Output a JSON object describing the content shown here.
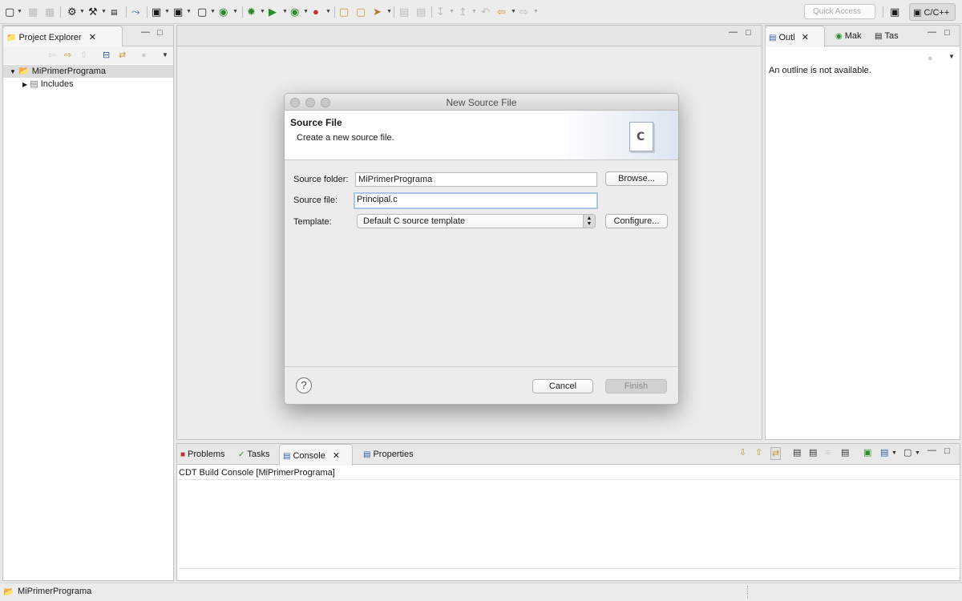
{
  "toolbar": {
    "quick_access_placeholder": "Quick Access",
    "perspective_label": "C/C++",
    "icons": [
      "new-icon",
      "save-icon",
      "save-all-icon",
      "build-config-icon",
      "build-icon",
      "binary-icon",
      "skip-breakpoints-icon",
      "new-c-project-icon",
      "new-folder-icon",
      "new-source-file-icon",
      "new-class-icon",
      "debug-icon",
      "run-icon",
      "run-coverage-icon",
      "external-tools-icon",
      "open-type-icon",
      "open-element-icon",
      "search-icon",
      "prev-annotation-icon",
      "next-annotation-icon",
      "back-icon",
      "forward-icon"
    ]
  },
  "explorer": {
    "tab_label": "Project Explorer",
    "tree": [
      {
        "label": "MiPrimerPrograma",
        "expanded": true
      },
      {
        "label": "Includes",
        "expanded": false
      }
    ]
  },
  "outline": {
    "tabs": [
      {
        "label": "Outl"
      },
      {
        "label": "Mak"
      },
      {
        "label": "Tas"
      }
    ],
    "message": "An outline is not available."
  },
  "console": {
    "tabs": [
      {
        "label": "Problems"
      },
      {
        "label": "Tasks"
      },
      {
        "label": "Console"
      },
      {
        "label": "Properties"
      }
    ],
    "header": "CDT Build Console [MiPrimerPrograma]"
  },
  "statusbar": {
    "text": "MiPrimerPrograma"
  },
  "dialog": {
    "title": "New Source File",
    "banner_title": "Source File",
    "banner_desc": "Create a new source file.",
    "source_folder_label": "Source folder:",
    "source_folder_value": "MiPrimerPrograma",
    "source_file_label": "Source file:",
    "source_file_value": "Principal.c",
    "template_label": "Template:",
    "template_value": "Default C source template",
    "browse_label": "Browse...",
    "configure_label": "Configure...",
    "cancel_label": "Cancel",
    "finish_label": "Finish",
    "help_symbol": "?",
    "file_icon_letter": "C"
  },
  "colors": {
    "accent": "#a9c6e8",
    "banner_gradient": "#dbe5f1",
    "run_green": "#2a8c2a"
  }
}
